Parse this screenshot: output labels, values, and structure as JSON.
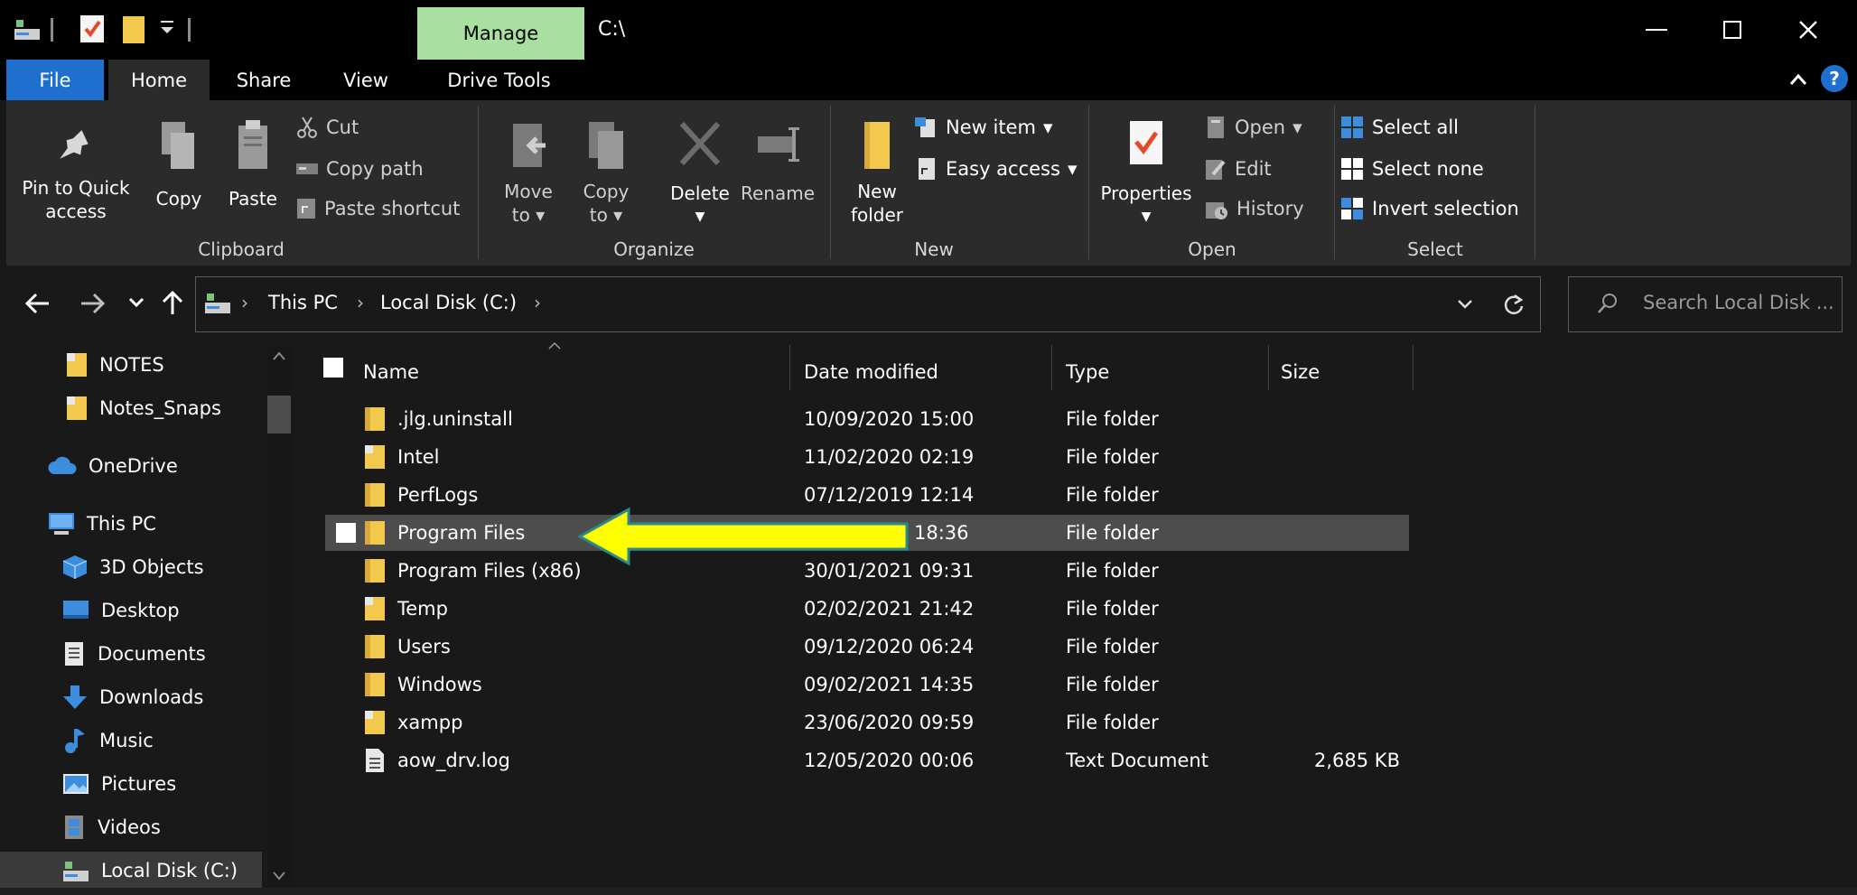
{
  "titlebar": {
    "manage_label": "Manage",
    "window_title": "C:\\",
    "minimize": "—",
    "maximize": "☐",
    "close": "✕"
  },
  "menu": {
    "tabs": [
      "File",
      "Home",
      "Share",
      "View",
      "Drive Tools"
    ],
    "help_glyph": "?"
  },
  "ribbon": {
    "clipboard": {
      "group_label": "Clipboard",
      "pin_l1": "Pin to Quick",
      "pin_l2": "access",
      "copy": "Copy",
      "paste": "Paste",
      "cut": "Cut",
      "copy_path": "Copy path",
      "paste_shortcut": "Paste shortcut"
    },
    "organize": {
      "group_label": "Organize",
      "move_l1": "Move",
      "move_l2": "to",
      "copy_l1": "Copy",
      "copy_l2": "to",
      "delete": "Delete",
      "rename": "Rename"
    },
    "new": {
      "group_label": "New",
      "folder_l1": "New",
      "folder_l2": "folder",
      "new_item": "New item",
      "easy_access": "Easy access"
    },
    "open": {
      "group_label": "Open",
      "properties": "Properties",
      "open": "Open",
      "edit": "Edit",
      "history": "History"
    },
    "select": {
      "group_label": "Select",
      "select_all": "Select all",
      "select_none": "Select none",
      "invert": "Invert selection"
    }
  },
  "address": {
    "crumbs": [
      "This PC",
      "Local Disk (C:)"
    ],
    "search_placeholder": "Search Local Disk ..."
  },
  "nav": {
    "items": [
      {
        "label": "NOTES",
        "icon": "folder-shortcut-icon"
      },
      {
        "label": "Notes_Snaps",
        "icon": "folder-shortcut-icon"
      },
      {
        "label": "OneDrive",
        "icon": "cloud-icon"
      },
      {
        "label": "This PC",
        "icon": "computer-icon"
      },
      {
        "label": "3D Objects",
        "icon": "cube-icon"
      },
      {
        "label": "Desktop",
        "icon": "desktop-icon"
      },
      {
        "label": "Documents",
        "icon": "document-icon"
      },
      {
        "label": "Downloads",
        "icon": "download-arrow-icon"
      },
      {
        "label": "Music",
        "icon": "music-note-icon"
      },
      {
        "label": "Pictures",
        "icon": "picture-icon"
      },
      {
        "label": "Videos",
        "icon": "video-icon"
      },
      {
        "label": "Local Disk (C:)",
        "icon": "drive-icon"
      }
    ]
  },
  "filelist": {
    "columns": {
      "name": "Name",
      "date": "Date modified",
      "type": "Type",
      "size": "Size"
    },
    "rows": [
      {
        "name": ".jlg.uninstall",
        "date": "10/09/2020 15:00",
        "type": "File folder",
        "size": "",
        "icon": "folder"
      },
      {
        "name": "Intel",
        "date": "11/02/2020 02:19",
        "type": "File folder",
        "size": "",
        "icon": "folder-shortcut"
      },
      {
        "name": "PerfLogs",
        "date": "07/12/2019 12:14",
        "type": "File folder",
        "size": "",
        "icon": "folder"
      },
      {
        "name": "Program Files",
        "date": "18:36",
        "type": "File folder",
        "size": "",
        "icon": "folder"
      },
      {
        "name": "Program Files (x86)",
        "date": "30/01/2021 09:31",
        "type": "File folder",
        "size": "",
        "icon": "folder"
      },
      {
        "name": "Temp",
        "date": "02/02/2021 21:42",
        "type": "File folder",
        "size": "",
        "icon": "folder-shortcut"
      },
      {
        "name": "Users",
        "date": "09/12/2020 06:24",
        "type": "File folder",
        "size": "",
        "icon": "folder"
      },
      {
        "name": "Windows",
        "date": "09/02/2021 14:35",
        "type": "File folder",
        "size": "",
        "icon": "folder"
      },
      {
        "name": "xampp",
        "date": "23/06/2020 09:59",
        "type": "File folder",
        "size": "",
        "icon": "folder-shortcut"
      },
      {
        "name": "aow_drv.log",
        "date": "12/05/2020 00:06",
        "type": "Text Document",
        "size": "2,685 KB",
        "icon": "file"
      }
    ]
  },
  "colors": {
    "accent_file_tab": "#1f6fcf",
    "manage_tab": "#a8e0a0",
    "highlight_arrow": "#ffff00",
    "folder": "#f2c94c"
  }
}
